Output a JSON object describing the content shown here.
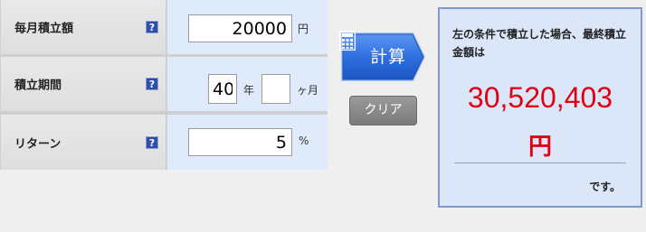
{
  "form": {
    "monthly": {
      "label": "毎月積立額",
      "help_icon": "?",
      "value": "20000",
      "unit": "円"
    },
    "period": {
      "label": "積立期間",
      "help_icon": "?",
      "years_value": "40",
      "years_unit": "年",
      "months_value": "",
      "months_unit": "ヶ月"
    },
    "return": {
      "label": "リターン",
      "help_icon": "?",
      "value": "5",
      "unit": "%"
    }
  },
  "buttons": {
    "calculate": "計算",
    "clear": "クリア"
  },
  "result": {
    "description": "左の条件で積立した場合、最終積立金額は",
    "amount": "30,520,403",
    "currency": "円",
    "suffix": "です。"
  },
  "colors": {
    "accent_red": "#e10010",
    "input_bg": "#dfeafb",
    "calc_button": "#2f6fe0",
    "help_icon": "#2e4ea8"
  }
}
